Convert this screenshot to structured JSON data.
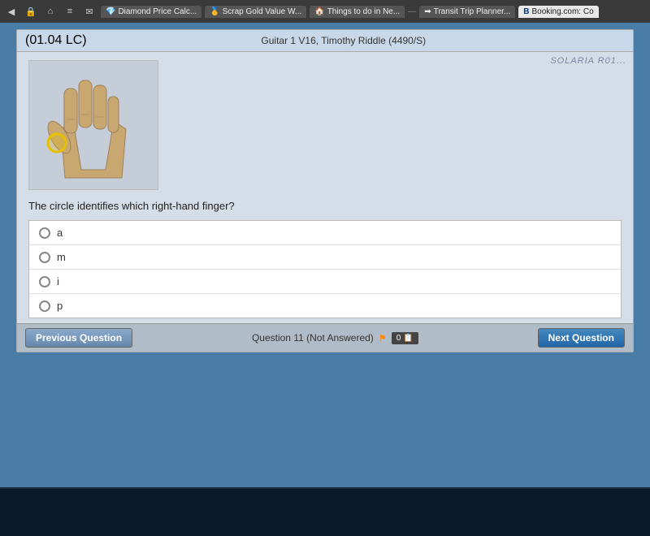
{
  "browser": {
    "tabs": [
      {
        "id": "diamond",
        "label": "Diamond Price Calc...",
        "favicon": "💎",
        "active": false
      },
      {
        "id": "scrap",
        "label": "Scrap Gold Value W...",
        "favicon": "🥇",
        "active": false
      },
      {
        "id": "things",
        "label": "Things to do in Ne...",
        "favicon": "🏠",
        "active": false
      },
      {
        "id": "transit",
        "label": "Transit Trip Planner...",
        "favicon": "➡",
        "active": false
      },
      {
        "id": "booking",
        "label": "Booking.com: Co",
        "favicon": "B",
        "active": false
      }
    ]
  },
  "quiz": {
    "label": "(01.04 LC)",
    "title": "Guitar 1 V16, Timothy Riddle (4490/S)",
    "watermark": "SOLARIA R01...",
    "question": "The circle identifies which right-hand finger?",
    "options": [
      {
        "id": "opt-a",
        "label": "a",
        "selected": false
      },
      {
        "id": "opt-m",
        "label": "m",
        "selected": false
      },
      {
        "id": "opt-i",
        "label": "i",
        "selected": false
      },
      {
        "id": "opt-p",
        "label": "p",
        "selected": false
      }
    ],
    "footer": {
      "prev_button": "Previous Question",
      "next_button": "Next Question",
      "status_label": "Question 11 (Not Answered)"
    }
  }
}
